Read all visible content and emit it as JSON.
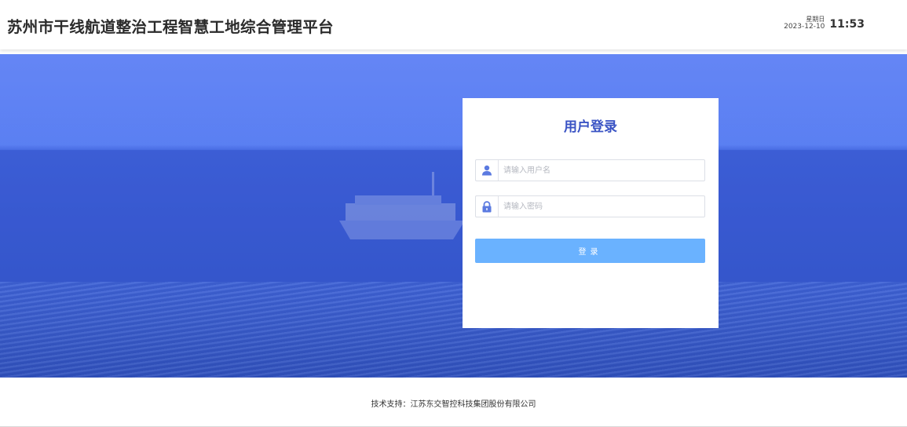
{
  "header": {
    "title": "苏州市干线航道整治工程智慧工地综合管理平台",
    "weekday": "星期日",
    "date": "2023-12-10",
    "time": "11:53"
  },
  "login": {
    "title": "用户登录",
    "username_placeholder": "请输入用户名",
    "username_value": "",
    "password_placeholder": "请输入密码",
    "password_value": "",
    "submit_label": "登录",
    "user_icon": "user-icon",
    "lock_icon": "lock-icon"
  },
  "footer": {
    "text": "技术支持：江苏东交智控科技集团股份有限公司"
  },
  "colors": {
    "title_accent": "#3a53c4",
    "button": "#6ab2ff",
    "hero_blue": "#4568e0",
    "icon": "#5b7ae0"
  }
}
